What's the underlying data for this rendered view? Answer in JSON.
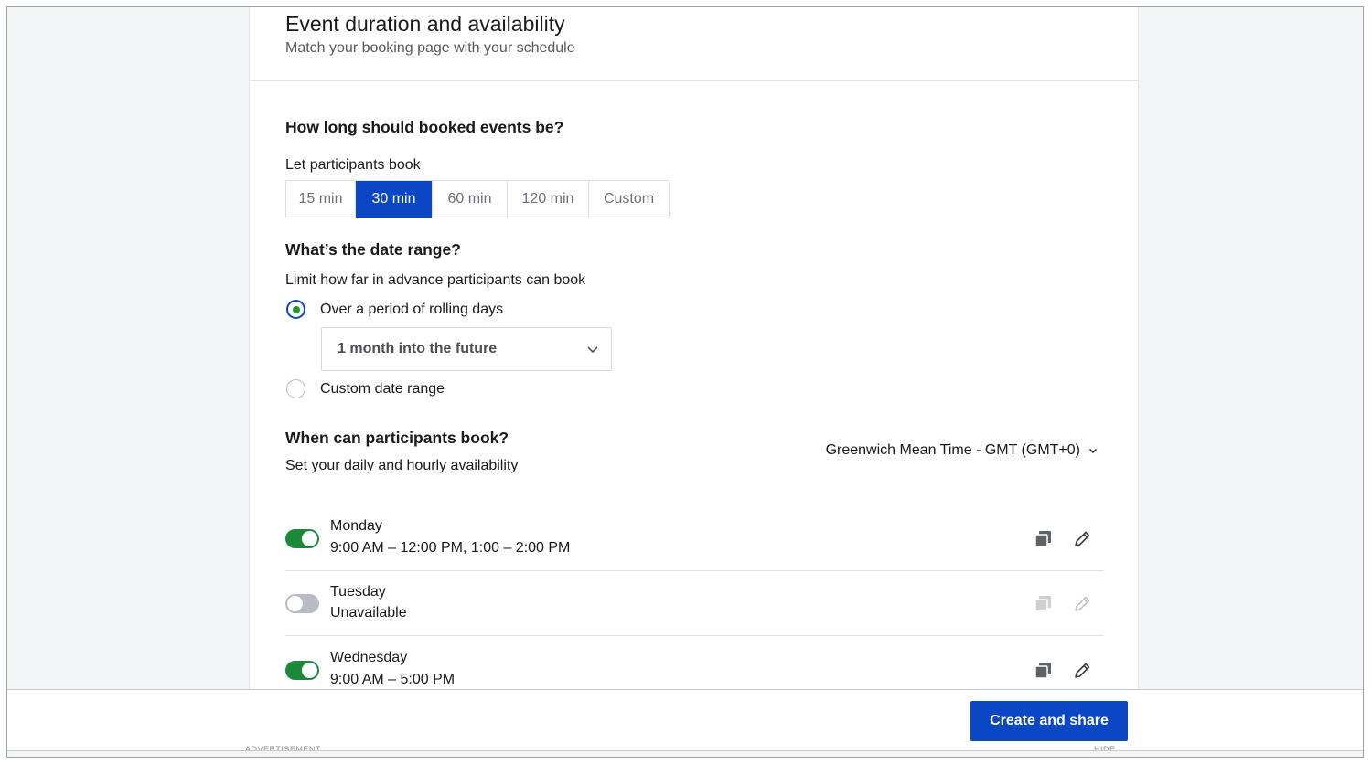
{
  "header": {
    "title": "Event duration and availability",
    "subtitle": "Match your booking page with your schedule"
  },
  "duration": {
    "heading": "How long should booked events be?",
    "label": "Let participants book",
    "options": [
      "15 min",
      "30 min",
      "60 min",
      "120 min",
      "Custom"
    ],
    "selected": "30 min"
  },
  "date_range": {
    "heading": "What’s the date range?",
    "label": "Limit how far in advance participants can book",
    "option_rolling": "Over a period of rolling days",
    "rolling_value": "1 month into the future",
    "option_custom": "Custom date range",
    "selected": "rolling"
  },
  "availability": {
    "heading": "When can participants book?",
    "label": "Set your daily and hourly availability",
    "timezone": "Greenwich Mean Time - GMT (GMT+0)",
    "days": [
      {
        "name": "Monday",
        "hours": "9:00 AM – 12:00 PM,  1:00 – 2:00 PM",
        "enabled": true
      },
      {
        "name": "Tuesday",
        "hours": "Unavailable",
        "enabled": false
      },
      {
        "name": "Wednesday",
        "hours": "9:00 AM – 5:00 PM",
        "enabled": true
      }
    ]
  },
  "footer": {
    "primary_label": "Create and share",
    "ad_left": "ADVERTISEMENT",
    "ad_right": "HIDE"
  },
  "icons": {
    "copy": "copy-icon",
    "edit": "pencil-icon",
    "chevron": "chevron-down-icon"
  },
  "colors": {
    "accent": "#0947c4",
    "toggle_on": "#1a8a3a",
    "radio_dot": "#1a9a3a"
  }
}
